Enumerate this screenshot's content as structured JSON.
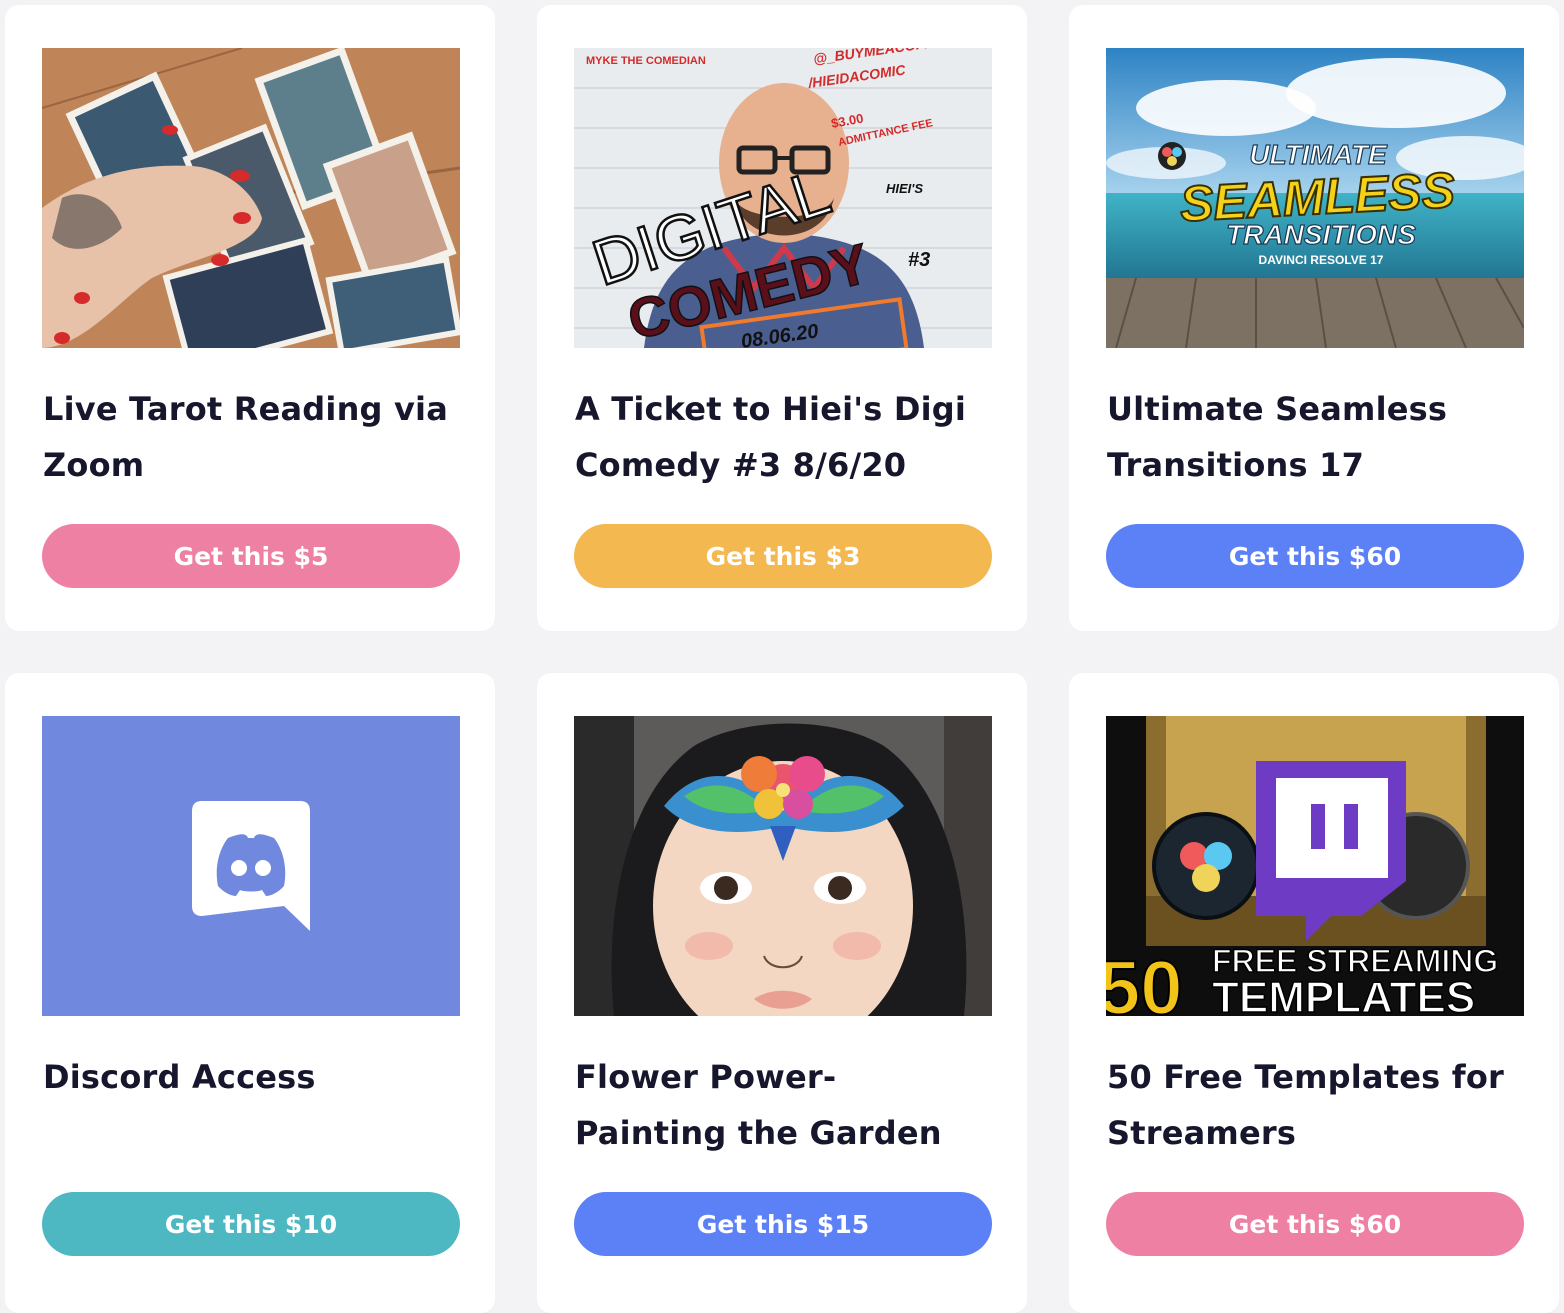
{
  "products": [
    {
      "title": "Live Tarot Reading via Zoom",
      "button": "Get this $5",
      "color": "#ee80a4"
    },
    {
      "title": "A Ticket to Hiei's Digi Comedy #3 8/6/20",
      "button": "Get this $3",
      "color": "#f4b850"
    },
    {
      "title": "Ultimate Seamless Transitions 17",
      "button": "Get this $60",
      "color": "#5c80f6"
    },
    {
      "title": "Discord Access",
      "button": "Get this $10",
      "color": "#4db8c2"
    },
    {
      "title": "Flower Power- Painting the Garden",
      "button": "Get this $15",
      "color": "#5c80f6"
    },
    {
      "title": "50 Free Templates for Streamers",
      "button": "Get this $60",
      "color": "#ee80a4"
    }
  ],
  "images": {
    "comedy": {
      "name_line": "MYKE THE COMEDIAN",
      "handle_1": "@_BUYMEACOFFEE.COM",
      "handle_2": "/HIEIDACOMIC",
      "price": "$3.00",
      "fee": "ADMITTANCE FEE",
      "owner": "HIEI'S",
      "word_1": "DIGITAL",
      "word_2": "COMEDY",
      "number": "#3",
      "date": "08.06.20"
    },
    "seamless": {
      "line_1": "ULTIMATE",
      "line_2": "SEAMLESS",
      "line_3": "TRANSITIONS",
      "line_4": "DAVINCI RESOLVE 17"
    },
    "templates": {
      "number": "50",
      "line_1": "FREE STREAMING",
      "line_2": "TEMPLATES"
    }
  },
  "colors": {
    "page_bg": "#f3f2f5",
    "card_bg": "#ffffff",
    "title_text": "#16162d",
    "discord_bg": "#7188df"
  }
}
